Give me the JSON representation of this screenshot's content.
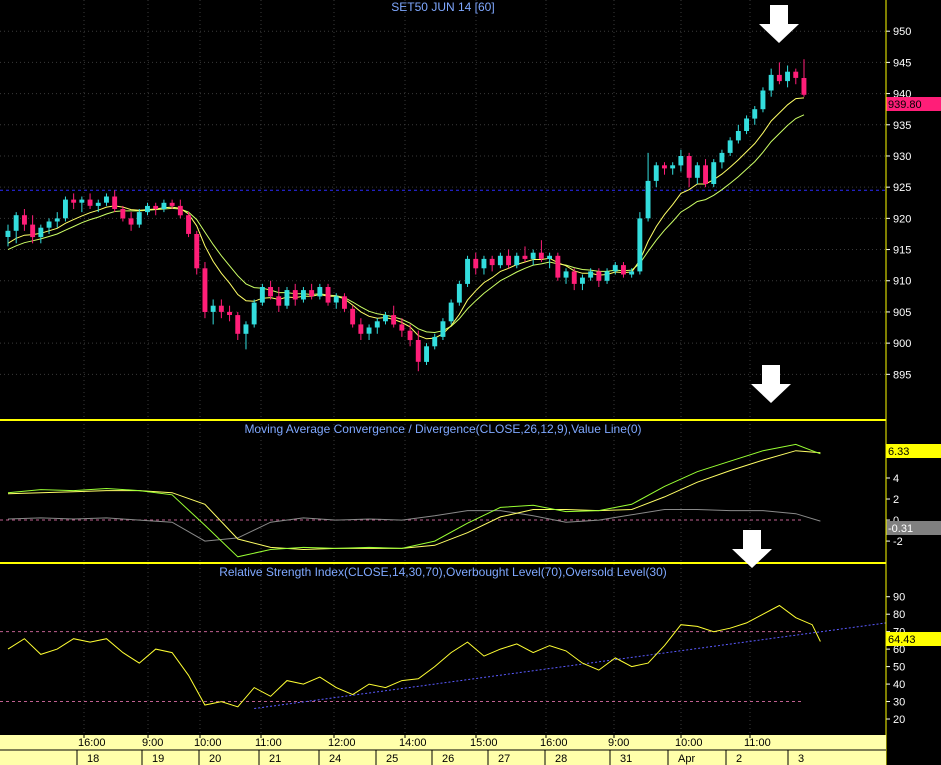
{
  "colors": {
    "background": "#000000",
    "frame": "#ffff00",
    "grid": "#3a3a3a",
    "up_candle": "#33dddd",
    "down_candle": "#ff1e78",
    "ma_fast": "#ffff66",
    "ma_slow": "#ccff66",
    "macd_line": "#99ff33",
    "signal_line": "#ffff66",
    "histogram": "#8a8a8a",
    "rsi_line": "#ffff33",
    "trendline": "#5a5aff",
    "dashed_level": "#c06090",
    "resistance": "#2a2aff",
    "last_price_badge": "#ff1e78",
    "macd_badge": "#ffff00",
    "hist_badge": "#808080",
    "rsi_badge": "#ffff00",
    "axis_strip": "#ffffaa"
  },
  "icons": [
    "down-arrow-icon",
    "down-arrow-icon",
    "down-arrow-icon"
  ],
  "chart_data": [
    {
      "type": "candlestick",
      "title": "SET50 JUN 14   [60]",
      "ylim": [
        888,
        955
      ],
      "yticks": [
        895,
        900,
        905,
        910,
        915,
        920,
        925,
        930,
        935,
        940,
        945,
        950
      ],
      "resistance_level": 924.5,
      "last_value_label": "939.80",
      "candles": [
        {
          "o": 917,
          "h": 919,
          "l": 915.5,
          "c": 918
        },
        {
          "o": 918,
          "h": 921,
          "l": 916,
          "c": 920.5
        },
        {
          "o": 920.5,
          "h": 921.5,
          "l": 918,
          "c": 919
        },
        {
          "o": 919,
          "h": 920.5,
          "l": 916,
          "c": 917
        },
        {
          "o": 917,
          "h": 919,
          "l": 916,
          "c": 918.5
        },
        {
          "o": 918.5,
          "h": 920,
          "l": 917.5,
          "c": 919.5
        },
        {
          "o": 919.5,
          "h": 921,
          "l": 918.5,
          "c": 920
        },
        {
          "o": 920,
          "h": 923.5,
          "l": 919.5,
          "c": 923
        },
        {
          "o": 923,
          "h": 924,
          "l": 921.5,
          "c": 922.5
        },
        {
          "o": 922.5,
          "h": 923.5,
          "l": 921,
          "c": 923
        },
        {
          "o": 923,
          "h": 924,
          "l": 921.5,
          "c": 922
        },
        {
          "o": 922,
          "h": 923,
          "l": 921,
          "c": 922.5
        },
        {
          "o": 922.5,
          "h": 924,
          "l": 922,
          "c": 923.5
        },
        {
          "o": 923.5,
          "h": 924.5,
          "l": 921,
          "c": 921.5
        },
        {
          "o": 921.5,
          "h": 922,
          "l": 919.5,
          "c": 920
        },
        {
          "o": 920,
          "h": 921,
          "l": 918,
          "c": 919
        },
        {
          "o": 919,
          "h": 921.5,
          "l": 918.5,
          "c": 921
        },
        {
          "o": 921,
          "h": 922.5,
          "l": 920.5,
          "c": 922
        },
        {
          "o": 922,
          "h": 922.5,
          "l": 920.5,
          "c": 921.5
        },
        {
          "o": 921.5,
          "h": 923,
          "l": 921,
          "c": 922.5
        },
        {
          "o": 922.5,
          "h": 923,
          "l": 921.5,
          "c": 922
        },
        {
          "o": 922,
          "h": 923,
          "l": 920,
          "c": 920.5
        },
        {
          "o": 920.5,
          "h": 921,
          "l": 917,
          "c": 917.5
        },
        {
          "o": 917.5,
          "h": 918,
          "l": 911,
          "c": 912
        },
        {
          "o": 912,
          "h": 913,
          "l": 904,
          "c": 905
        },
        {
          "o": 905,
          "h": 907,
          "l": 903,
          "c": 906
        },
        {
          "o": 906,
          "h": 907,
          "l": 904,
          "c": 905
        },
        {
          "o": 905,
          "h": 906,
          "l": 903.5,
          "c": 904.5
        },
        {
          "o": 904.5,
          "h": 905,
          "l": 900.5,
          "c": 901.5
        },
        {
          "o": 901.5,
          "h": 903.5,
          "l": 899,
          "c": 903
        },
        {
          "o": 903,
          "h": 907,
          "l": 902.5,
          "c": 906.5
        },
        {
          "o": 906.5,
          "h": 909.5,
          "l": 906,
          "c": 909
        },
        {
          "o": 909,
          "h": 910,
          "l": 907,
          "c": 907.5
        },
        {
          "o": 907.5,
          "h": 909,
          "l": 905,
          "c": 906
        },
        {
          "o": 906,
          "h": 909,
          "l": 905.5,
          "c": 908.5
        },
        {
          "o": 908.5,
          "h": 909.5,
          "l": 906,
          "c": 907
        },
        {
          "o": 907,
          "h": 909,
          "l": 906.5,
          "c": 908.5
        },
        {
          "o": 908.5,
          "h": 909.5,
          "l": 907,
          "c": 907.5
        },
        {
          "o": 907.5,
          "h": 909.5,
          "l": 907,
          "c": 909
        },
        {
          "o": 909,
          "h": 909.5,
          "l": 906,
          "c": 906.5
        },
        {
          "o": 906.5,
          "h": 908,
          "l": 905.5,
          "c": 907.5
        },
        {
          "o": 907.5,
          "h": 908,
          "l": 905,
          "c": 905.5
        },
        {
          "o": 905.5,
          "h": 906,
          "l": 902.5,
          "c": 903
        },
        {
          "o": 903,
          "h": 904,
          "l": 900.5,
          "c": 901.5
        },
        {
          "o": 901.5,
          "h": 903,
          "l": 900.5,
          "c": 902.5
        },
        {
          "o": 902.5,
          "h": 904,
          "l": 901.5,
          "c": 903.5
        },
        {
          "o": 903.5,
          "h": 905,
          "l": 903,
          "c": 904.5
        },
        {
          "o": 904.5,
          "h": 906,
          "l": 902.5,
          "c": 903
        },
        {
          "o": 903,
          "h": 904,
          "l": 901,
          "c": 902
        },
        {
          "o": 902,
          "h": 903,
          "l": 899.5,
          "c": 900.5
        },
        {
          "o": 900.5,
          "h": 902,
          "l": 895.5,
          "c": 897
        },
        {
          "o": 897,
          "h": 900,
          "l": 896.5,
          "c": 899.5
        },
        {
          "o": 899.5,
          "h": 901.5,
          "l": 899,
          "c": 901
        },
        {
          "o": 901,
          "h": 904,
          "l": 900.5,
          "c": 903.5
        },
        {
          "o": 903.5,
          "h": 907,
          "l": 903,
          "c": 906.5
        },
        {
          "o": 906.5,
          "h": 910,
          "l": 906,
          "c": 909.5
        },
        {
          "o": 909.5,
          "h": 914,
          "l": 909,
          "c": 913.5
        },
        {
          "o": 913.5,
          "h": 914.5,
          "l": 911,
          "c": 912
        },
        {
          "o": 912,
          "h": 914,
          "l": 911,
          "c": 913.5
        },
        {
          "o": 913.5,
          "h": 914,
          "l": 911.5,
          "c": 912.5
        },
        {
          "o": 912.5,
          "h": 914.5,
          "l": 912,
          "c": 914
        },
        {
          "o": 914,
          "h": 915,
          "l": 912,
          "c": 912.5
        },
        {
          "o": 912.5,
          "h": 914.5,
          "l": 912,
          "c": 914
        },
        {
          "o": 914,
          "h": 915.5,
          "l": 913,
          "c": 913.5
        },
        {
          "o": 913.5,
          "h": 915,
          "l": 912.5,
          "c": 914.5
        },
        {
          "o": 914.5,
          "h": 916.5,
          "l": 913,
          "c": 913.5
        },
        {
          "o": 913.5,
          "h": 914.5,
          "l": 912,
          "c": 914
        },
        {
          "o": 914,
          "h": 914.5,
          "l": 910,
          "c": 910.5
        },
        {
          "o": 910.5,
          "h": 912,
          "l": 909.5,
          "c": 911.5
        },
        {
          "o": 911.5,
          "h": 912,
          "l": 908.5,
          "c": 909.5
        },
        {
          "o": 909.5,
          "h": 911,
          "l": 908.5,
          "c": 910.5
        },
        {
          "o": 910.5,
          "h": 912,
          "l": 910,
          "c": 911.5
        },
        {
          "o": 911.5,
          "h": 912,
          "l": 909,
          "c": 910
        },
        {
          "o": 910,
          "h": 912,
          "l": 909.5,
          "c": 911.5
        },
        {
          "o": 911.5,
          "h": 913,
          "l": 911,
          "c": 912.5
        },
        {
          "o": 912.5,
          "h": 913,
          "l": 910.5,
          "c": 911
        },
        {
          "o": 911,
          "h": 912,
          "l": 910.5,
          "c": 911.5
        },
        {
          "o": 911.5,
          "h": 921,
          "l": 911,
          "c": 920
        },
        {
          "o": 920,
          "h": 930.5,
          "l": 919.5,
          "c": 926
        },
        {
          "o": 926,
          "h": 929,
          "l": 925,
          "c": 928.5
        },
        {
          "o": 928.5,
          "h": 929,
          "l": 927,
          "c": 928
        },
        {
          "o": 928,
          "h": 929,
          "l": 927,
          "c": 928.5
        },
        {
          "o": 928.5,
          "h": 931,
          "l": 927.5,
          "c": 930
        },
        {
          "o": 930,
          "h": 930.5,
          "l": 925,
          "c": 926.5
        },
        {
          "o": 926.5,
          "h": 929,
          "l": 925.5,
          "c": 928.5
        },
        {
          "o": 928.5,
          "h": 929.5,
          "l": 925,
          "c": 925.5
        },
        {
          "o": 925.5,
          "h": 929.5,
          "l": 925,
          "c": 929
        },
        {
          "o": 929,
          "h": 931,
          "l": 928,
          "c": 930.5
        },
        {
          "o": 930.5,
          "h": 933,
          "l": 930,
          "c": 932.5
        },
        {
          "o": 932.5,
          "h": 935,
          "l": 932,
          "c": 934
        },
        {
          "o": 934,
          "h": 936.5,
          "l": 933.5,
          "c": 936
        },
        {
          "o": 936,
          "h": 938,
          "l": 935,
          "c": 937.5
        },
        {
          "o": 937.5,
          "h": 941,
          "l": 937,
          "c": 940.5
        },
        {
          "o": 940.5,
          "h": 944,
          "l": 939.5,
          "c": 943
        },
        {
          "o": 943,
          "h": 945,
          "l": 941.5,
          "c": 942
        },
        {
          "o": 942,
          "h": 944.5,
          "l": 941,
          "c": 943.5
        },
        {
          "o": 943.5,
          "h": 944,
          "l": 941.5,
          "c": 942.5
        },
        {
          "o": 942.5,
          "h": 945.5,
          "l": 939.5,
          "c": 939.8
        }
      ],
      "ma_fast": [
        916,
        916.8,
        917.3,
        917.4,
        917.6,
        918,
        918.4,
        919.2,
        919.8,
        920.4,
        920.9,
        921.3,
        921.8,
        922,
        921.8,
        921.4,
        921.3,
        921.4,
        921.5,
        921.7,
        921.8,
        921.6,
        920.7,
        918.8,
        915.6,
        913.1,
        911.2,
        909.6,
        907.8,
        906.8,
        906.7,
        907.2,
        907.3,
        907,
        907.4,
        907.3,
        907.5,
        907.5,
        907.8,
        907.5,
        907.5,
        907.1,
        906.1,
        905,
        904.3,
        904,
        904.1,
        903.8,
        903.3,
        902.6,
        901.2,
        900.7,
        900.8,
        901.5,
        902.8,
        904.6,
        906.9,
        908.4,
        909.7,
        910.5,
        911.5,
        912,
        912.6,
        913,
        913.4,
        913.4,
        913.6,
        912.9,
        912.4,
        911.6,
        911.2,
        911.2,
        910.9,
        911,
        911.4,
        911.3,
        911.4,
        913.3,
        916.3,
        918.7,
        920.6,
        922.2,
        924,
        924.6,
        925.5,
        925.5,
        926.2,
        927.1,
        928.2,
        929.4,
        930.7,
        932,
        933.7,
        935.6,
        936.9,
        938.2,
        939.2,
        939.3
      ],
      "ma_slow": [
        915,
        915.6,
        916.1,
        916.4,
        916.7,
        917.1,
        917.5,
        918.1,
        918.7,
        919.3,
        919.8,
        920.2,
        920.7,
        921.1,
        921.2,
        921.2,
        921.2,
        921.3,
        921.4,
        921.5,
        921.6,
        921.5,
        921,
        919.8,
        917.8,
        915.8,
        914,
        912.4,
        910.8,
        909.5,
        908.9,
        908.8,
        908.5,
        908.1,
        908.1,
        907.9,
        907.9,
        907.8,
        907.9,
        907.7,
        907.6,
        907.3,
        906.6,
        905.8,
        905.1,
        904.7,
        904.5,
        904.2,
        903.8,
        903.2,
        902.3,
        901.8,
        901.7,
        902,
        902.7,
        903.9,
        905.5,
        906.8,
        908,
        909,
        910,
        910.7,
        911.4,
        912,
        912.5,
        912.7,
        913,
        912.7,
        912.5,
        912.1,
        911.8,
        911.7,
        911.5,
        911.5,
        911.7,
        911.6,
        911.7,
        912.8,
        914.7,
        916.5,
        918.1,
        919.5,
        921,
        921.8,
        922.7,
        923,
        923.7,
        924.6,
        925.6,
        926.7,
        927.9,
        929.1,
        930.6,
        932.3,
        933.6,
        934.9,
        936,
        936.6
      ]
    },
    {
      "type": "line",
      "title": "Moving Average Convergence / Divergence(CLOSE,26,12,9),Value Line(0)",
      "ylim": [
        -3.8,
        7.9
      ],
      "yticks": [
        -2,
        0,
        2,
        4
      ],
      "value_labels": [
        "6.33",
        "-0.31"
      ],
      "x": [
        0,
        4,
        8,
        12,
        16,
        20,
        24,
        28,
        32,
        36,
        40,
        44,
        48,
        52,
        56,
        60,
        64,
        68,
        72,
        76,
        80,
        84,
        88,
        92,
        96,
        99
      ],
      "series": [
        {
          "values": [
            2.6,
            2.9,
            2.8,
            3.0,
            2.8,
            2.4,
            -0.5,
            -3.5,
            -2.8,
            -2.6,
            -2.7,
            -2.6,
            -2.7,
            -2.0,
            -0.3,
            1.2,
            1.4,
            0.8,
            0.9,
            1.5,
            3.2,
            4.6,
            5.6,
            6.6,
            7.2,
            6.3
          ]
        },
        {
          "values": [
            2.5,
            2.6,
            2.7,
            2.8,
            2.8,
            2.6,
            1.5,
            -1.8,
            -2.6,
            -2.8,
            -2.7,
            -2.7,
            -2.7,
            -2.4,
            -1.2,
            0.3,
            1.0,
            1.0,
            0.9,
            1.0,
            2.2,
            3.6,
            4.7,
            5.7,
            6.6,
            6.4
          ]
        },
        {
          "values": [
            0.1,
            0.2,
            0.1,
            0.2,
            0.0,
            -0.2,
            -2.0,
            -1.7,
            -0.2,
            0.2,
            0.0,
            0.1,
            0.0,
            0.4,
            0.9,
            0.9,
            0.4,
            -0.2,
            0.0,
            0.5,
            1.0,
            1.0,
            0.9,
            0.9,
            0.6,
            -0.1
          ]
        }
      ],
      "value_line": 0
    },
    {
      "type": "line",
      "title": "Relative Strength Index(CLOSE,14,30,70),Overbought Level(70),Oversold Level(30)",
      "ylim": [
        12,
        99
      ],
      "yticks": [
        20,
        30,
        40,
        50,
        60,
        70,
        80,
        90
      ],
      "overbought": 70,
      "oversold": 30,
      "value_label": "64.43",
      "x": [
        0,
        2,
        4,
        6,
        8,
        10,
        12,
        14,
        16,
        18,
        20,
        22,
        24,
        26,
        28,
        30,
        32,
        34,
        36,
        38,
        40,
        42,
        44,
        46,
        48,
        50,
        52,
        54,
        56,
        58,
        60,
        62,
        64,
        66,
        68,
        70,
        72,
        74,
        76,
        78,
        80,
        82,
        84,
        86,
        88,
        90,
        92,
        94,
        96,
        98,
        99
      ],
      "values": [
        60,
        66,
        57,
        60,
        66,
        64,
        66,
        58,
        52,
        60,
        58,
        45,
        28,
        30,
        27,
        38,
        33,
        42,
        40,
        44,
        38,
        34,
        40,
        38,
        42,
        43,
        50,
        58,
        64,
        56,
        60,
        63,
        58,
        62,
        59,
        52,
        48,
        55,
        50,
        52,
        62,
        74,
        73,
        70,
        72,
        75,
        80,
        85,
        78,
        74,
        64.4
      ],
      "trendline": {
        "x": [
          30,
          115
        ],
        "y": [
          26,
          75
        ]
      }
    }
  ],
  "x_axis": {
    "time_labels": [
      "16:00",
      "9:00",
      "10:00",
      "11:00",
      "12:00",
      "14:00",
      "15:00",
      "16:00",
      "9:00",
      "10:00",
      "11:00"
    ],
    "date_labels": [
      "18",
      "19",
      "20",
      "21",
      "24",
      "25",
      "26",
      "27",
      "28",
      "31",
      "Apr",
      "2",
      "3"
    ]
  }
}
